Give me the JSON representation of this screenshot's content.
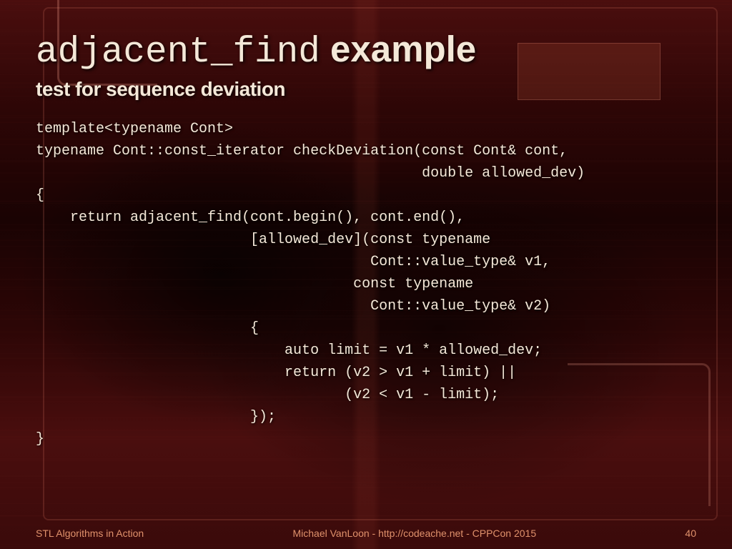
{
  "title": {
    "mono": "adjacent_find",
    "rest": " example"
  },
  "subtitle": "test for sequence deviation",
  "code": "template<typename Cont>\ntypename Cont::const_iterator checkDeviation(const Cont& cont,\n                                             double allowed_dev)\n{\n    return adjacent_find(cont.begin(), cont.end(),\n                         [allowed_dev](const typename\n                                       Cont::value_type& v1,\n                                     const typename\n                                       Cont::value_type& v2)\n                         {\n                             auto limit = v1 * allowed_dev;\n                             return (v2 > v1 + limit) ||\n                                    (v2 < v1 - limit);\n                         });\n}",
  "footer": {
    "left": "STL Algorithms in Action",
    "center": "Michael VanLoon - http://codeache.net - CPPCon 2015",
    "right": "40"
  }
}
